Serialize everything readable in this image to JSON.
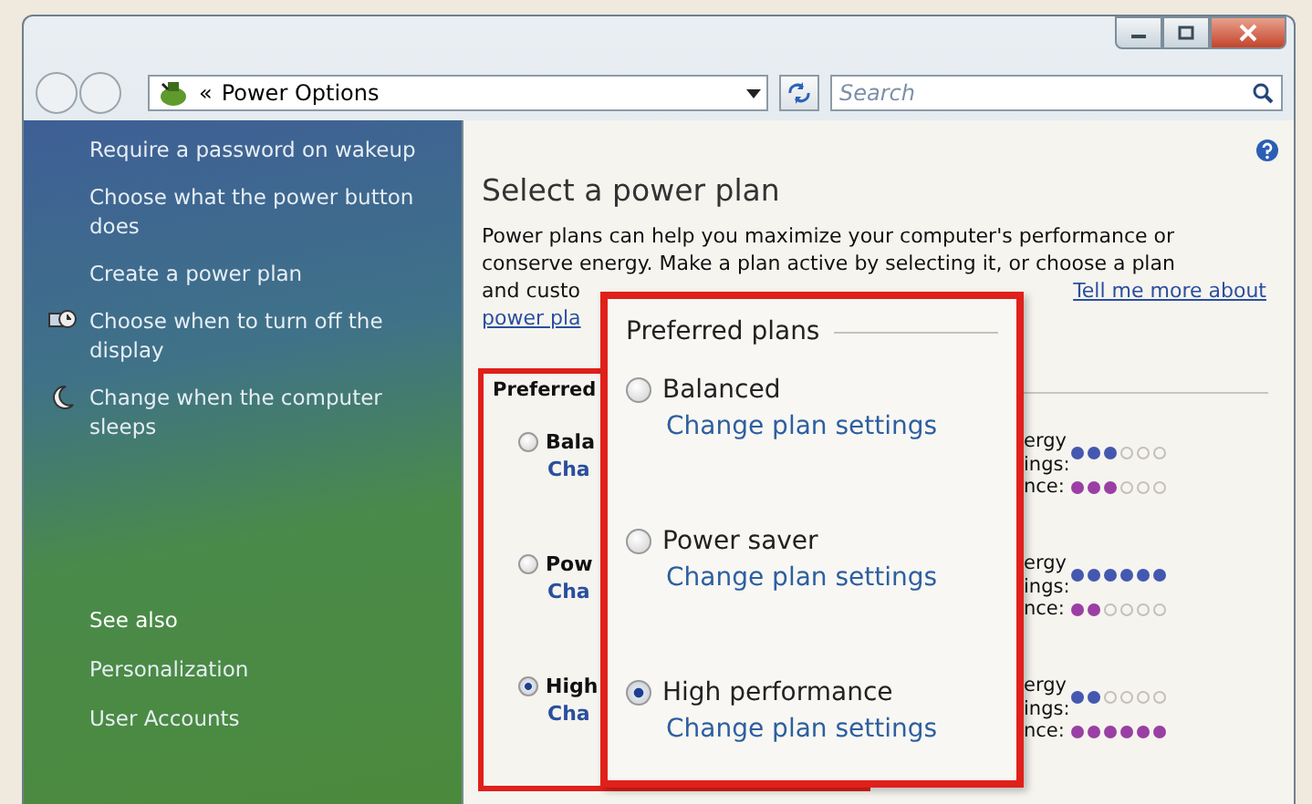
{
  "address_bar": {
    "prefix": "«",
    "location": "Power Options"
  },
  "search": {
    "placeholder": "Search"
  },
  "sidebar": {
    "tasks": [
      {
        "label": "Require a password on wakeup",
        "kind": "plain"
      },
      {
        "label": "Choose what the power button does",
        "kind": "plain"
      },
      {
        "label": "Create a power plan",
        "kind": "plain"
      },
      {
        "label": "Choose when to turn off the display",
        "kind": "display"
      },
      {
        "label": "Change when the computer sleeps",
        "kind": "sleep"
      }
    ],
    "see_also": {
      "heading": "See also",
      "links": [
        "Personalization",
        "User Accounts"
      ]
    }
  },
  "main": {
    "title": "Select a power plan",
    "intro_lines": [
      "Power plans can help you maximize your computer's performance or",
      "conserve energy. Make a plan active by selecting it, or choose a plan"
    ],
    "intro_fragment": "and custo",
    "more_link": "Tell me more about",
    "link_fragment": "power pla",
    "group_label": "Preferred",
    "plans": [
      {
        "name": "Bala",
        "link": "Cha",
        "selected": false,
        "energy": {
          "label_1": "ergy",
          "label_2": "ings:",
          "stars": 3
        },
        "performance": {
          "label": "nce:",
          "stars": 3
        }
      },
      {
        "name": "Pow",
        "link": "Cha",
        "selected": false,
        "energy": {
          "label_1": "ergy",
          "label_2": "ings:",
          "stars": 6
        },
        "performance": {
          "label": "nce:",
          "stars": 2
        }
      },
      {
        "name": "High",
        "link": "Cha",
        "selected": true,
        "energy": {
          "label_1": "ergy",
          "label_2": "ings:",
          "stars": 2
        },
        "performance": {
          "label": "nce:",
          "stars": 6
        }
      }
    ]
  },
  "callout": {
    "title": "Preferred plans",
    "plans": [
      {
        "name": "Balanced",
        "link": "Change plan settings",
        "selected": false
      },
      {
        "name": "Power saver",
        "link": "Change plan settings",
        "selected": false
      },
      {
        "name": "High performance",
        "link": "Change plan settings",
        "selected": true
      }
    ]
  }
}
